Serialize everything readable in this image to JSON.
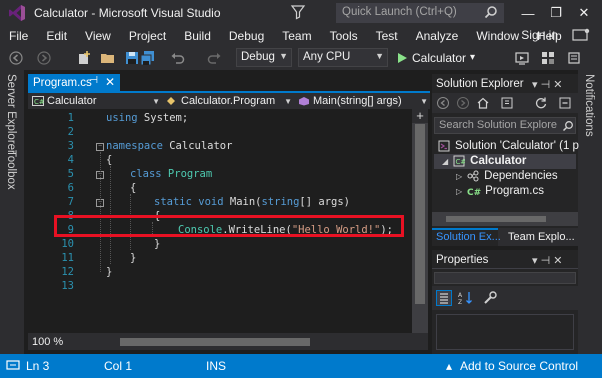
{
  "window": {
    "title": "Calculator - Microsoft Visual Studio",
    "quick_launch_placeholder": "Quick Launch (Ctrl+Q)",
    "min_glyph": "—",
    "max_glyph": "❐",
    "close_glyph": "✕"
  },
  "menu": {
    "items": [
      "File",
      "Edit",
      "View",
      "Project",
      "Build",
      "Debug",
      "Team",
      "Tools",
      "Test",
      "Analyze",
      "Window",
      "Help"
    ],
    "sign_in": "Sign in"
  },
  "toolbar": {
    "configuration": "Debug",
    "platform": "Any CPU",
    "start_label": "Calculator",
    "start_dropdown": "▾"
  },
  "side_tabs": {
    "left": [
      "Server Explorer",
      "Toolbox"
    ],
    "right": [
      "Notifications"
    ]
  },
  "editor": {
    "tab_label": "Program.cs",
    "tab_pin": "⊣",
    "tab_close": "✕",
    "nav_project": "Calculator",
    "nav_class": "Calculator.Program",
    "nav_member": "Main(string[] args)",
    "zoom": "100 %",
    "line_numbers": [
      "1",
      "2",
      "3",
      "4",
      "5",
      "6",
      "7",
      "8",
      "9",
      "10",
      "11",
      "12",
      "13"
    ],
    "lines": {
      "l1_kw": "using",
      "l1_rest": " System;",
      "l3_kw": "namespace",
      "l3_rest": " Calculator",
      "l4": "{",
      "l5_kw": "class",
      "l5_type": " Program",
      "l6": "{",
      "l7_kw1": "static",
      "l7_kw2": " void",
      "l7_rest1": " Main(",
      "l7_kw3": "string",
      "l7_rest2": "[] args)",
      "l8": "{",
      "l9_type": "Console",
      "l9_rest1": ".WriteLine(",
      "l9_str": "\"Hello World!\"",
      "l9_rest2": ");",
      "l10": "}",
      "l11": "}",
      "l12": "}"
    },
    "highlight_color": "#e81123"
  },
  "solution_explorer": {
    "title": "Solution Explorer",
    "title_icons": "▾ ⊣ ✕",
    "search_placeholder": "Search Solution Explore",
    "tree": {
      "solution": "Solution 'Calculator' (1 p",
      "project": "Calculator",
      "dependencies": "Dependencies",
      "file": "Program.cs"
    },
    "tabs": [
      "Solution Ex...",
      "Team Explo..."
    ]
  },
  "properties": {
    "title": "Properties",
    "title_icons": "▾ ⊣ ✕"
  },
  "status": {
    "line": "Ln 3",
    "col": "Col 1",
    "mode": "INS",
    "source_control": "Add to Source Control",
    "source_control_arrow": "▴"
  },
  "colors": {
    "accent": "#007acc",
    "chrome": "#2d2d30",
    "editor_bg": "#1e1e1e",
    "keyword": "#569cd6",
    "type": "#4ec9b0",
    "string": "#d69d85"
  }
}
